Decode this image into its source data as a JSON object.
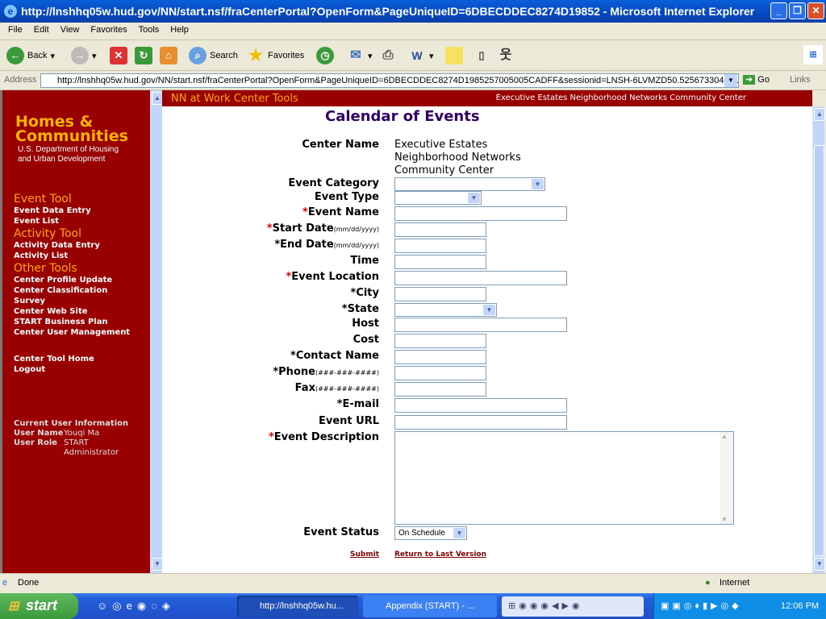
{
  "window": {
    "title": "http://lnshhq05w.hud.gov/NN/start.nsf/fraCenterPortal?OpenForm&PageUniqueID=6DBECDDEC8274D19852 - Microsoft Internet Explorer"
  },
  "menu": [
    "File",
    "Edit",
    "View",
    "Favorites",
    "Tools",
    "Help"
  ],
  "toolbar": {
    "back": "Back",
    "search": "Search",
    "favorites": "Favorites"
  },
  "address": {
    "label": "Address",
    "url": "http://lnshhq05w.hud.gov/NN/start.nsf/fraCenterPortal?OpenForm&PageUniqueID=6DBECDDEC8274D1985257005005CADFF&sessionid=LNSH-6LVMZD50.5256733043412",
    "go": "Go",
    "links": "Links"
  },
  "sidebar": {
    "logo": {
      "line1": "Homes &",
      "line2": "Communities",
      "line3": "U.S. Department of Housing",
      "line4": "and Urban Development"
    },
    "sections": [
      {
        "title": "Event Tool",
        "links": [
          "Event Data Entry",
          "Event List"
        ]
      },
      {
        "title": "Activity Tool",
        "links": [
          "Activity Data Entry",
          "Activity List"
        ]
      },
      {
        "title": "Other Tools",
        "links": [
          "Center Profile Update",
          "Center Classification",
          "Survey",
          "Center Web Site",
          "START Business Plan",
          "Center User Management"
        ]
      }
    ],
    "home": "Center Tool Home",
    "logout": "Logout",
    "user_info": {
      "heading": "Current User Information",
      "name_label": "User Name",
      "name": "Youqi Ma",
      "role_label": "User Role",
      "role_1": "START",
      "role_2": "Administrator"
    }
  },
  "header": {
    "tools": "NN at Work Center Tools",
    "center": "Executive Estates Neighborhood Networks Community Center"
  },
  "form": {
    "title": "Calendar of Events",
    "center_name_label": "Center Name",
    "center_name_1": "Executive Estates",
    "center_name_2": "Neighborhood Networks",
    "center_name_3": "Community Center",
    "event_category": "Event Category",
    "event_type": "Event Type",
    "event_name": "Event Name",
    "start_date": "Start Date",
    "end_date": "End Date",
    "date_hint": "(mm/dd/yyyy)",
    "time": "Time",
    "event_location": "Event Location",
    "city": "City",
    "state": "State",
    "host": "Host",
    "cost": "Cost",
    "contact_name": "Contact Name",
    "phone": "Phone",
    "fax": "Fax",
    "phone_hint": "(###-###-####)",
    "email": "E-mail",
    "event_url": "Event URL",
    "event_description": "Event Description",
    "event_status": "Event Status",
    "event_status_value": "On Schedule",
    "required_mark": "*",
    "submit": "Submit",
    "return": "Return to Last Version"
  },
  "status": {
    "text": "Done",
    "zone": "Internet"
  },
  "taskbar": {
    "start": "start",
    "tasks": [
      "http://lnshhq05w.hu...",
      "Appendix (START) - ..."
    ],
    "clock": "12:06 PM"
  }
}
